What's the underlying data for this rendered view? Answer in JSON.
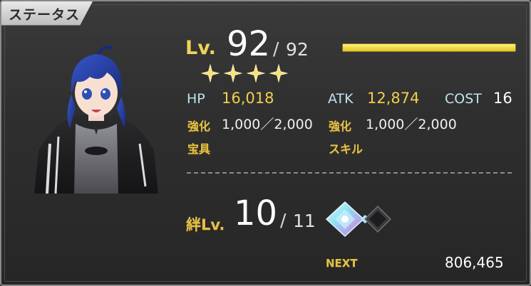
{
  "header": {
    "title": "ステータス"
  },
  "level": {
    "label": "Lv.",
    "current": "92",
    "slash": "/",
    "max": "92",
    "exp_fill": 1.0
  },
  "rarity": {
    "stars": 4,
    "icon": "star-icon"
  },
  "stats": {
    "hp_label": "HP",
    "hp_value": "16,018",
    "atk_label": "ATK",
    "atk_value": "12,874",
    "cost_label": "COST",
    "cost_value": "16"
  },
  "enhancement": {
    "label_1": "強化",
    "value_1": "1,000／2,000",
    "label_2": "強化",
    "value_2": "1,000／2,000"
  },
  "sections": {
    "noble_phantasm": "宝具",
    "skill": "スキル"
  },
  "bond": {
    "label": "絆Lv.",
    "current": "10",
    "slash": "/",
    "max": "11",
    "icons": [
      "crystal-icon",
      "dark-crystal-icon"
    ]
  },
  "next": {
    "label": "NEXT",
    "value": "806,465"
  },
  "colors": {
    "gold": "#f2cf4a",
    "label_gold": "#e3c14a",
    "stat_label": "#bfe3ee",
    "bar_fill": "#e2c526"
  }
}
